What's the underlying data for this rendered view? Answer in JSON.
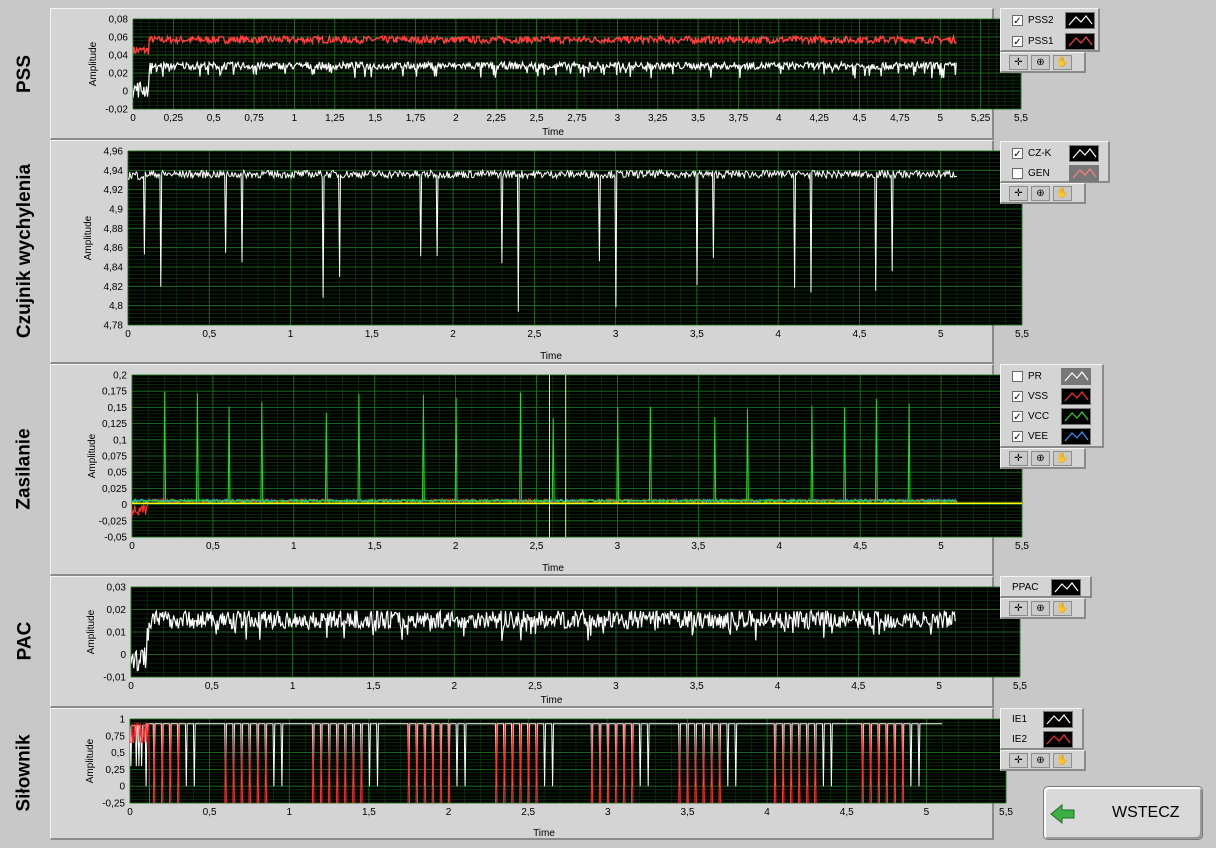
{
  "colors": {
    "plot_bg": "#000000",
    "grid": "#1f7a1f",
    "pss2": "#ffffff",
    "pss1": "#ff4040",
    "czk": "#ffffff",
    "gen": "#ff8080",
    "pr": "#ffffff",
    "vss": "#ff3030",
    "vcc": "#22dd22",
    "vee": "#3399ff",
    "cursor": "#ffff00",
    "ppac": "#ffffff",
    "ie1": "#ffffff",
    "ie2": "#ff3030"
  },
  "graphs": [
    {
      "id": "pss",
      "row_label": "PSS",
      "y_label": "Amplitude",
      "x_label": "Time",
      "y_ticks": [
        "0,08",
        "0,06",
        "0,04",
        "0,02",
        "0",
        "-0,02"
      ],
      "x_ticks": [
        "0",
        "0,25",
        "0,5",
        "0,75",
        "1",
        "1,25",
        "1,5",
        "1,75",
        "2",
        "2,25",
        "2,5",
        "2,75",
        "3",
        "3,25",
        "3,5",
        "3,75",
        "4",
        "4,25",
        "4,5",
        "4,75",
        "5",
        "5,25",
        "5,5"
      ],
      "legend": [
        {
          "name": "PSS2",
          "checked": true,
          "color_key": "pss2"
        },
        {
          "name": "PSS1",
          "checked": true,
          "color_key": "pss1"
        }
      ]
    },
    {
      "id": "czujnik",
      "row_label": "Czujnik wychylenia",
      "y_label": "Amplitude",
      "x_label": "Time",
      "y_ticks": [
        "4,96",
        "4,94",
        "4,92",
        "4,9",
        "4,88",
        "4,86",
        "4,84",
        "4,82",
        "4,8",
        "4,78"
      ],
      "x_ticks": [
        "0",
        "0,5",
        "1",
        "1,5",
        "2",
        "2,5",
        "3",
        "3,5",
        "4",
        "4,5",
        "5",
        "5,5"
      ],
      "legend": [
        {
          "name": "CZ-K",
          "checked": true,
          "color_key": "czk"
        },
        {
          "name": "GEN",
          "checked": false,
          "color_key": "gen"
        }
      ]
    },
    {
      "id": "zasilanie",
      "row_label": "Zasilanie",
      "y_label": "Amplitude",
      "x_label": "Time",
      "y_ticks": [
        "0,2",
        "0,175",
        "0,15",
        "0,125",
        "0,1",
        "0,075",
        "0,05",
        "0,025",
        "0",
        "-0,025",
        "-0,05"
      ],
      "x_ticks": [
        "0",
        "0,5",
        "1",
        "1,5",
        "2",
        "2,5",
        "3",
        "3,5",
        "4",
        "4,5",
        "5",
        "5,5"
      ],
      "legend": [
        {
          "name": "PR",
          "checked": false,
          "color_key": "pr"
        },
        {
          "name": "VSS",
          "checked": true,
          "color_key": "vss"
        },
        {
          "name": "VCC",
          "checked": true,
          "color_key": "vcc"
        },
        {
          "name": "VEE",
          "checked": true,
          "color_key": "vee"
        }
      ]
    },
    {
      "id": "pac",
      "row_label": "PAC",
      "y_label": "Amplitude",
      "x_label": "Time",
      "y_ticks": [
        "0,03",
        "0,02",
        "0,01",
        "0",
        "-0,01"
      ],
      "x_ticks": [
        "0",
        "0,5",
        "1",
        "1,5",
        "2",
        "2,5",
        "3",
        "3,5",
        "4",
        "4,5",
        "5",
        "5,5"
      ],
      "legend": [
        {
          "name": "PPAC",
          "checked": null,
          "color_key": "ppac"
        }
      ]
    },
    {
      "id": "silownik",
      "row_label": "Siłownik",
      "y_label": "Amplitude",
      "x_label": "Time",
      "y_ticks": [
        "1",
        "0,75",
        "0,5",
        "0,25",
        "0",
        "-0,25"
      ],
      "x_ticks": [
        "0",
        "0,5",
        "1",
        "1,5",
        "2",
        "2,5",
        "3",
        "3,5",
        "4",
        "4,5",
        "5",
        "5,5"
      ],
      "legend": [
        {
          "name": "IE1",
          "checked": null,
          "color_key": "ie1"
        },
        {
          "name": "IE2",
          "checked": null,
          "color_key": "ie2"
        }
      ]
    }
  ],
  "palette_icons": [
    "cursor-move-icon",
    "zoom-icon",
    "pan-hand-icon"
  ],
  "back_button": {
    "label": "WSTECZ",
    "icon": "arrow-left-icon"
  }
}
